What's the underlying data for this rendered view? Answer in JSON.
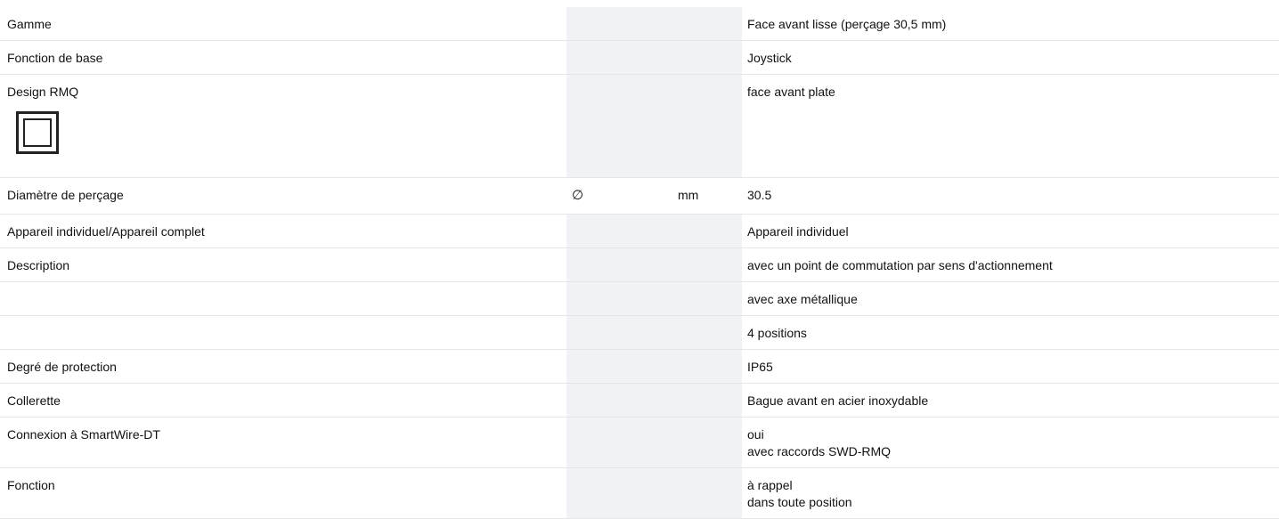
{
  "rows": [
    {
      "label": "Gamme",
      "symbol": "",
      "unit": "",
      "values": [
        "Face avant lisse (perçage 30,5 mm)"
      ]
    },
    {
      "label": "Fonction de base",
      "symbol": "",
      "unit": "",
      "values": [
        "Joystick"
      ]
    },
    {
      "label": "Design RMQ",
      "symbol": "",
      "unit": "",
      "values": [
        "face avant plate"
      ],
      "icon": "rmq-flat-front-icon"
    },
    {
      "label": "Diamètre de perçage",
      "symbol": "∅",
      "unit": "mm",
      "values": [
        "30.5"
      ]
    },
    {
      "label": "Appareil individuel/Appareil complet",
      "symbol": "",
      "unit": "",
      "values": [
        "Appareil individuel"
      ]
    },
    {
      "label": "Description",
      "symbol": "",
      "unit": "",
      "values": [
        "avec un point de commutation par sens d'actionnement"
      ]
    },
    {
      "label": "",
      "symbol": "",
      "unit": "",
      "values": [
        "avec axe métallique"
      ]
    },
    {
      "label": "",
      "symbol": "",
      "unit": "",
      "values": [
        "4 positions"
      ]
    },
    {
      "label": "Degré de protection",
      "symbol": "",
      "unit": "",
      "values": [
        "IP65"
      ]
    },
    {
      "label": "Collerette",
      "symbol": "",
      "unit": "",
      "values": [
        "Bague avant en acier inoxydable"
      ]
    },
    {
      "label": "Connexion à SmartWire-DT",
      "symbol": "",
      "unit": "",
      "values": [
        "oui",
        "avec raccords SWD-RMQ"
      ]
    },
    {
      "label": "Fonction",
      "symbol": "",
      "unit": "",
      "values": [
        "à rappel",
        "dans toute position"
      ]
    }
  ]
}
